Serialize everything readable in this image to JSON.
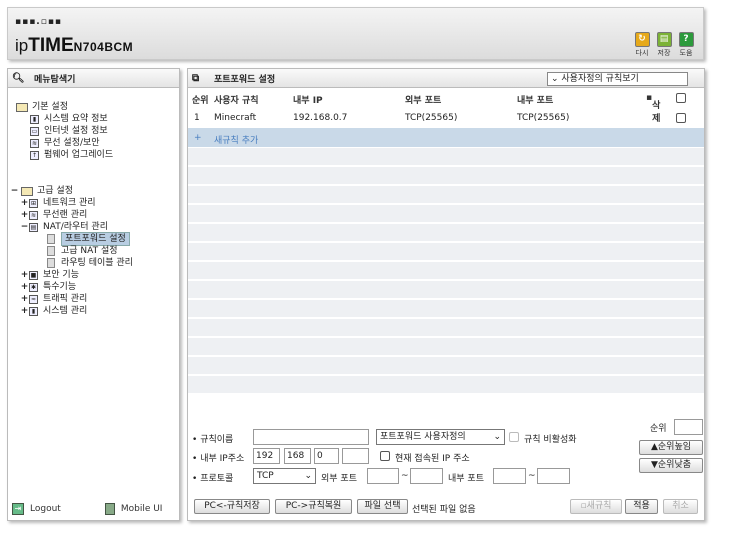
{
  "header": {
    "logo_dots": "▪▪▪.▫▪▪",
    "brand_ip": "ip",
    "brand_time": "TIME",
    "model": "N704BCM",
    "buttons": [
      {
        "label": "다시",
        "icon": "refresh-icon"
      },
      {
        "label": "저장",
        "icon": "save-icon"
      },
      {
        "label": "도움",
        "icon": "help-icon"
      }
    ],
    "colors": {
      "refresh": "#e6a91a",
      "save": "#7cb236",
      "help": "#2c9a3c"
    }
  },
  "sidebar": {
    "title": "메뉴탐색기",
    "basic": {
      "label": "기본 설정",
      "items": [
        "시스템 요약 정보",
        "인터넷 설정 정보",
        "무선 설정/보안",
        "펌웨어 업그레이드"
      ]
    },
    "advanced": {
      "label": "고급 설정",
      "items": [
        {
          "toggle": "+",
          "label": "네트워크 관리"
        },
        {
          "toggle": "+",
          "label": "무선랜 관리"
        },
        {
          "toggle": "−",
          "label": "NAT/라우터 관리"
        }
      ],
      "nat_children": [
        "포트포워드 설정",
        "고급 NAT 설정",
        "라우팅 테이블 관리"
      ],
      "items2": [
        {
          "toggle": "+",
          "label": "보안 기능"
        },
        {
          "toggle": "+",
          "label": "특수기능"
        },
        {
          "toggle": "+",
          "label": "트래픽 관리"
        },
        {
          "toggle": "+",
          "label": "시스템 관리"
        }
      ]
    },
    "logout": "Logout",
    "mobile": "Mobile UI"
  },
  "main": {
    "title": "포트포워드 설정",
    "view_select": "사용자정의 규칙보기",
    "columns": {
      "rank": "순위",
      "rule": "사용자 규칙",
      "ip": "내부 IP",
      "ext": "외부 포트",
      "int": "내부 포트",
      "del": "삭제"
    },
    "rows": [
      {
        "rank": "1",
        "rule": "Minecraft",
        "ip": "192.168.0.7",
        "ext": "TCP(25565)",
        "int": "TCP(25565)"
      }
    ],
    "add_rule": "새규칙 추가",
    "add_plus": "+"
  },
  "form": {
    "rank_label": "순위",
    "rule_name_label": "규칙이름",
    "rule_type": "포트포워드 사용자정의",
    "disable_label": "규칙 비활성화",
    "up_btn": "▲순위높임",
    "down_btn": "▼순위낮춤",
    "ip_label": "내부 IP주소",
    "ip": [
      "192",
      "168",
      "0",
      ""
    ],
    "current_ip_label": "현재 접속된 IP 주소",
    "protocol_label": "프로토콜",
    "protocol": "TCP",
    "ext_port_label": "외부 포트",
    "int_port_label": "내부 포트",
    "tilde": "~",
    "bullet": "•"
  },
  "footer": {
    "save_pc": "PC<-규칙저장",
    "restore_pc": "PC->규칙복원",
    "file_select": "파일 선택",
    "no_file": "선택된 파일 없음",
    "new_rule": "새규칙",
    "apply": "적용",
    "cancel": "취소"
  }
}
